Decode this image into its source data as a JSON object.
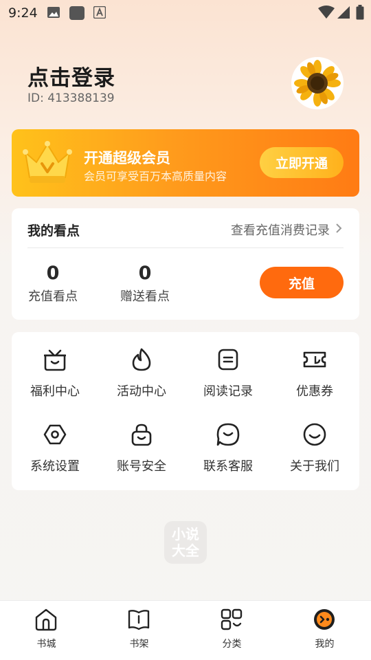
{
  "status_bar": {
    "time": "9:24",
    "icons": [
      "image-icon",
      "app-square-icon",
      "font-a-icon",
      "wifi-icon",
      "signal-icon",
      "battery-icon"
    ]
  },
  "profile": {
    "name": "点击登录",
    "id_text": "ID: 413388139"
  },
  "vip": {
    "title": "开通超级会员",
    "subtitle": "会员可享受百万本高质量内容",
    "button": "立即开通"
  },
  "points": {
    "title": "我的看点",
    "records_link": "查看充值消费记录",
    "recharged_value": "0",
    "recharged_label": "充值看点",
    "gifted_value": "0",
    "gifted_label": "赠送看点",
    "recharge_button": "充值"
  },
  "menu": {
    "items": [
      {
        "label": "福利中心",
        "icon": "gift-box-icon"
      },
      {
        "label": "活动中心",
        "icon": "flame-icon"
      },
      {
        "label": "阅读记录",
        "icon": "reading-record-icon"
      },
      {
        "label": "优惠券",
        "icon": "coupon-icon"
      },
      {
        "label": "系统设置",
        "icon": "settings-icon"
      },
      {
        "label": "账号安全",
        "icon": "lock-icon"
      },
      {
        "label": "联系客服",
        "icon": "customer-service-icon"
      },
      {
        "label": "关于我们",
        "icon": "smile-icon"
      }
    ]
  },
  "watermark": {
    "line1": "小说",
    "line2": "大全"
  },
  "tabbar": {
    "tabs": [
      {
        "label": "书城",
        "icon": "bookstore-icon"
      },
      {
        "label": "书架",
        "icon": "bookshelf-icon"
      },
      {
        "label": "分类",
        "icon": "category-icon"
      },
      {
        "label": "我的",
        "icon": "profile-face-icon"
      }
    ],
    "active_index": 3
  },
  "colors": {
    "accent": "#ff6a0e",
    "vip_gradient_start": "#ffc21b",
    "vip_gradient_end": "#ff7b14"
  }
}
